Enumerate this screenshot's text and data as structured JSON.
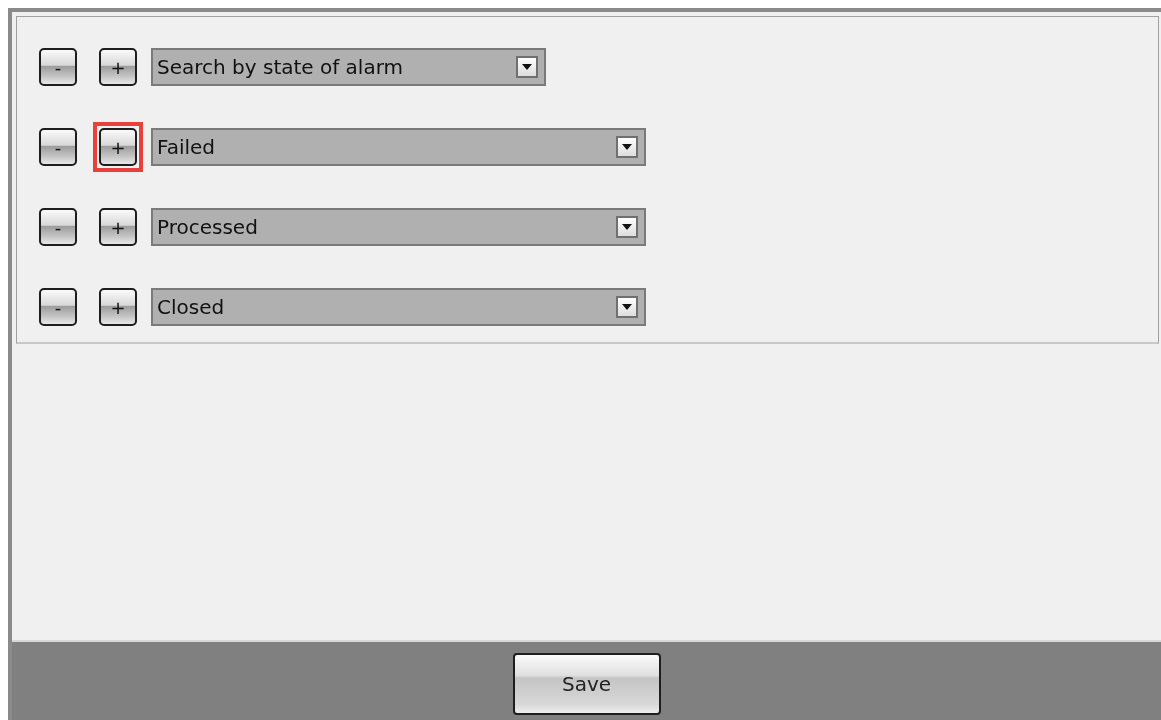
{
  "filters": [
    {
      "kind": "heading",
      "minus": "-",
      "plus": "+",
      "plus_highlighted": false,
      "value": "Search by state of alarm"
    },
    {
      "kind": "state",
      "minus": "-",
      "plus": "+",
      "plus_highlighted": true,
      "value": "Failed"
    },
    {
      "kind": "state",
      "minus": "-",
      "plus": "+",
      "plus_highlighted": false,
      "value": "Processed"
    },
    {
      "kind": "state",
      "minus": "-",
      "plus": "+",
      "plus_highlighted": false,
      "value": "Closed"
    }
  ],
  "footer": {
    "save_button": "Save"
  }
}
